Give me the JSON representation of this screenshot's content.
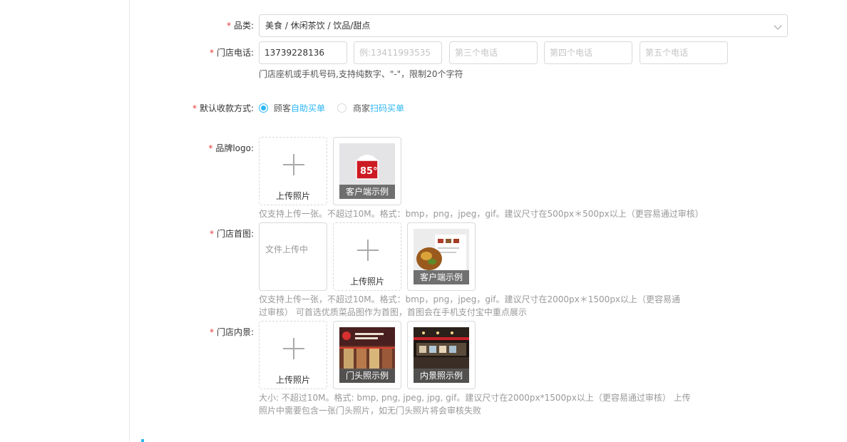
{
  "form": {
    "category": {
      "label": "品类:",
      "value": "美食 / 休闲茶饮 / 饮品/甜点"
    },
    "phone": {
      "label": "门店电话:",
      "value": "13739228136",
      "placeholders": [
        "例:13411993535",
        "第三个电话",
        "第四个电话",
        "第五个电话"
      ],
      "hint": "门店座机或手机号码,支持纯数字、\"-\"，限制20个字符"
    },
    "payment": {
      "label": "默认收款方式:",
      "option1_prefix": "顾客",
      "option1_link": "自助买单",
      "option2_prefix": "商家",
      "option2_link": "扫码买单",
      "selected": "option1"
    },
    "logo": {
      "label": "品牌logo:",
      "upload_text": "上传照片",
      "example_caption": "客户端示例",
      "hint": "仅支持上传一张。不超过10M。格式：bmp，png，jpeg，gif。建议尺寸在500px＊500px以上（更容易通过审核）"
    },
    "cover": {
      "label": "门店首图:",
      "loading_text": "文件上传中",
      "upload_text": "上传照片",
      "example_caption": "客户端示例",
      "hint_line1": "仅支持上传一张，不超过10M。格式：bmp，png，jpeg，gif。建议尺寸在2000px＊1500px以上（更容易通",
      "hint_line2": "过审核） 可首选优质菜品图作为首图，首图会在手机支付宝中重点展示"
    },
    "interior": {
      "label": "门店内景:",
      "upload_text": "上传照片",
      "example1_caption": "门头照示例",
      "example2_caption": "内景照示例",
      "hint_line1": "大小: 不超过10M。格式: bmp, png, jpeg, jpg, gif。建议尺寸在2000px*1500px以上（更容易通过审核） 上传",
      "hint_line2": "照片中需要包含一张门头照片，如无门头照片将会审核失败"
    }
  },
  "colors": {
    "accent": "#2db7f5",
    "required": "#e4393c"
  }
}
